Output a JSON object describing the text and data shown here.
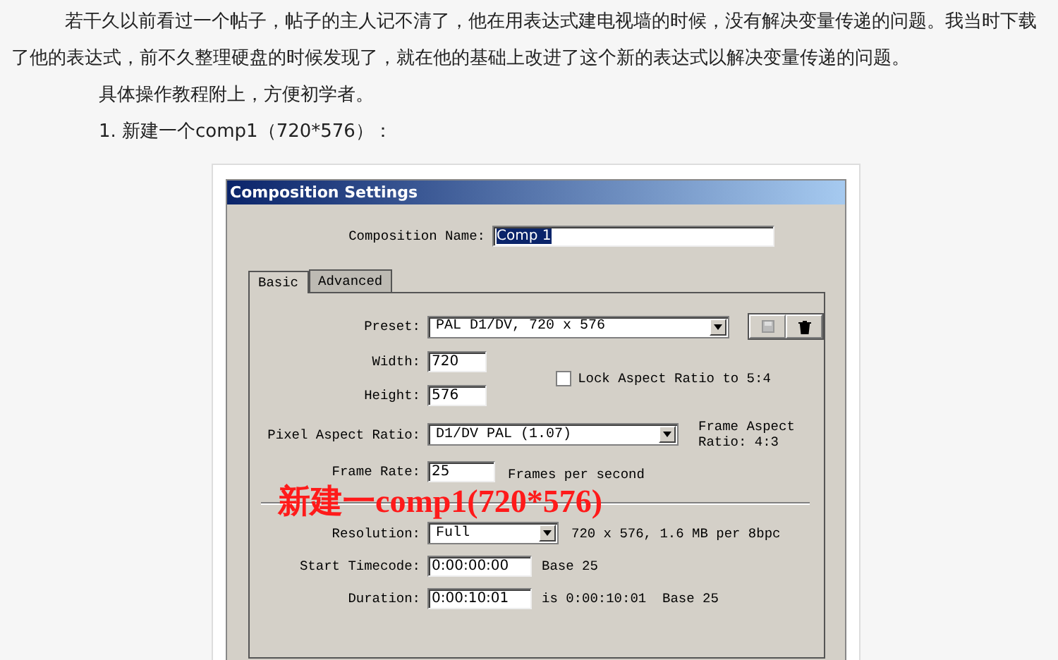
{
  "article": {
    "paragraphs": [
      "若干久以前看过一个帖子，帖子的主人记不清了，他在用表达式建电视墙的时候，没有解决变量传递的问题。我当时下载了他的表达式，前不久整理硬盘的时候发现了，就在他的基础上改进了这个新的表达式以解决变量传递的问题。"
    ],
    "notes": [
      "具体操作教程附上，方便初学者。",
      "1. 新建一个comp1（720*576）："
    ]
  },
  "dialog": {
    "title": "Composition Settings",
    "name_label": "Composition Name:",
    "name_value": "Comp 1",
    "tabs": [
      {
        "label": "Basic",
        "selected": true
      },
      {
        "label": "Advanced",
        "selected": false
      }
    ],
    "preset": {
      "label": "Preset:",
      "value": "PAL D1/DV, 720 x 576"
    },
    "width": {
      "label": "Width:",
      "value": "720"
    },
    "height": {
      "label": "Height:",
      "value": "576"
    },
    "lock": {
      "label": "Lock Aspect Ratio to 5:4",
      "checked": false
    },
    "pixel_aspect": {
      "label": "Pixel Aspect Ratio:",
      "value": "D1/DV PAL (1.07)",
      "frame_aspect": "Frame Aspect Ratio: 4:3"
    },
    "frame_rate": {
      "label": "Frame Rate:",
      "value": "25",
      "unit": "Frames per second"
    },
    "resolution": {
      "label": "Resolution:",
      "value": "Full",
      "info": "720 x 576, 1.6 MB per 8bpc"
    },
    "start_timecode": {
      "label": "Start Timecode:",
      "value": "0:00:00:00",
      "note": "Base 25"
    },
    "duration": {
      "label": "Duration:",
      "value": "0:00:10:01",
      "note": "is 0:00:10:01  Base 25"
    }
  },
  "annotation": "新建一comp1(720*576)"
}
